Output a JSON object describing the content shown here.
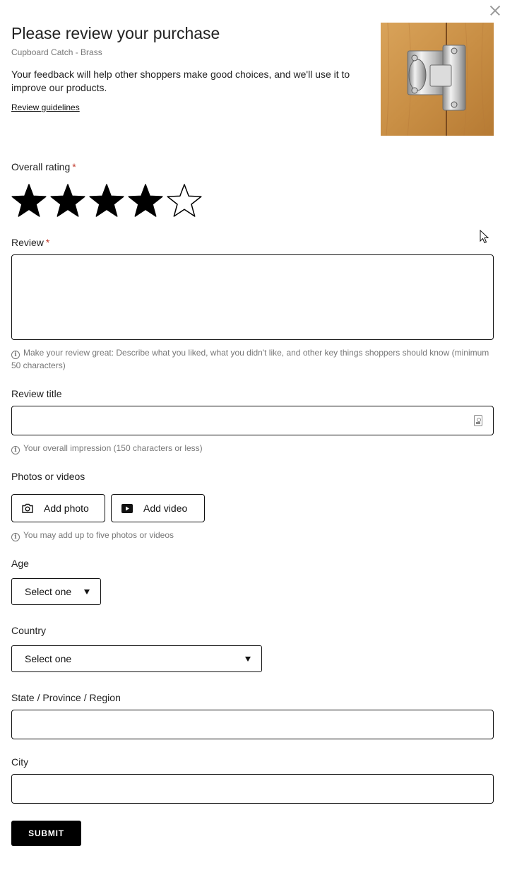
{
  "header": {
    "title": "Please review your purchase",
    "product_name": "Cupboard Catch - Brass",
    "intro": "Your feedback will help other shoppers make good choices, and we'll use it to improve our products.",
    "guidelines_link": "Review guidelines"
  },
  "rating": {
    "label": "Overall rating",
    "required_mark": "*",
    "value": 4,
    "max": 5
  },
  "review": {
    "label": "Review",
    "required_mark": "*",
    "value": "",
    "hint": "Make your review great: Describe what you liked, what you didn't like, and other key things shoppers should know (minimum 50 characters)"
  },
  "review_title": {
    "label": "Review title",
    "value": "",
    "hint": "Your overall impression (150 characters or less)"
  },
  "media": {
    "label": "Photos or videos",
    "add_photo": "Add photo",
    "add_video": "Add video",
    "hint": "You may add up to five photos or videos"
  },
  "age": {
    "label": "Age",
    "selected": "Select one"
  },
  "country": {
    "label": "Country",
    "selected": "Select one"
  },
  "state": {
    "label": "State / Province / Region",
    "value": ""
  },
  "city": {
    "label": "City",
    "value": ""
  },
  "submit_label": "SUBMIT",
  "colors": {
    "required": "#c0392b",
    "submit_bg": "#000000",
    "hint_text": "#777777"
  }
}
